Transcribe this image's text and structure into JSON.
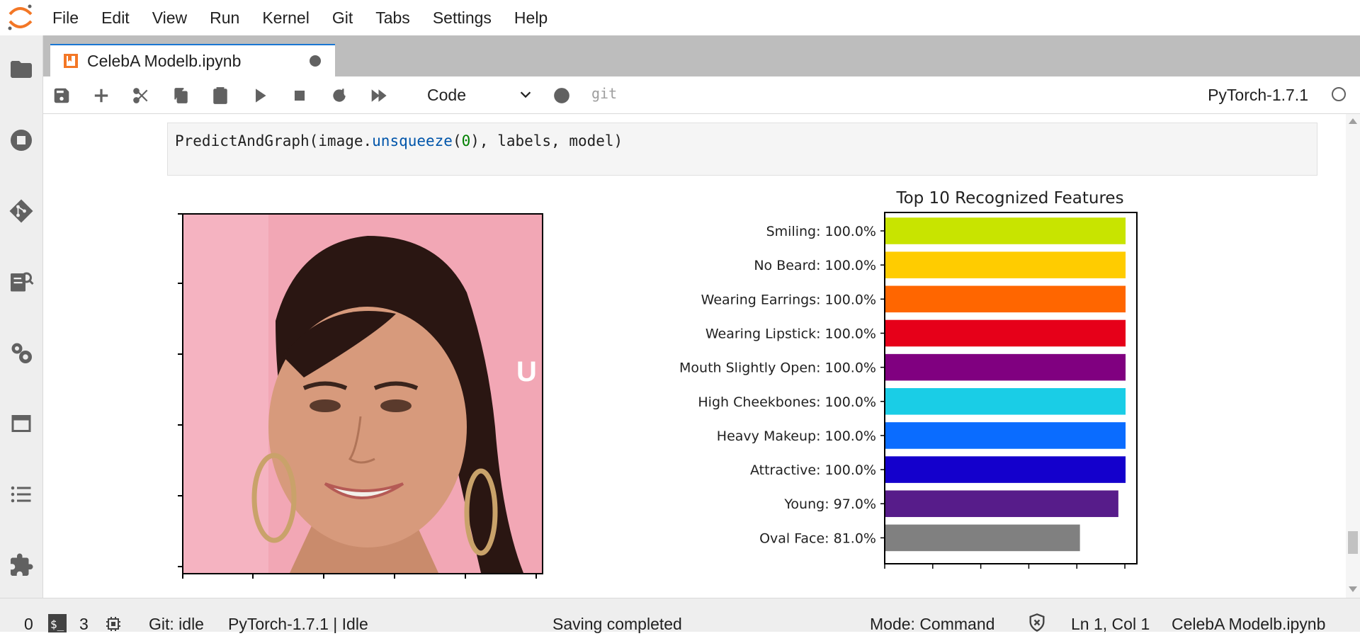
{
  "menu": [
    "File",
    "Edit",
    "View",
    "Run",
    "Kernel",
    "Git",
    "Tabs",
    "Settings",
    "Help"
  ],
  "tab": {
    "title": "CelebA Modelb.ipynb"
  },
  "toolbar": {
    "cell_type": "Code",
    "git_label": "git",
    "kernel_name": "PyTorch-1.7.1"
  },
  "cell": {
    "code_prefix": "PredictAndGraph(image.",
    "code_fn": "unsqueeze",
    "code_open": "(",
    "code_num": "0",
    "code_suffix": "), labels, model)"
  },
  "chart_data": {
    "type": "bar",
    "orientation": "horizontal",
    "title": "Top 10 Recognized Features",
    "categories": [
      "Smiling: 100.0%",
      "No Beard: 100.0%",
      "Wearing Earrings: 100.0%",
      "Wearing Lipstick: 100.0%",
      "Mouth Slightly Open: 100.0%",
      "High Cheekbones: 100.0%",
      "Heavy Makeup: 100.0%",
      "Attractive: 100.0%",
      "Young: 97.0%",
      "Oval Face: 81.0%"
    ],
    "values": [
      100.0,
      100.0,
      100.0,
      100.0,
      100.0,
      100.0,
      100.0,
      100.0,
      97.0,
      81.0
    ],
    "colors": [
      "#c8e400",
      "#ffcc00",
      "#ff6600",
      "#e60019",
      "#800080",
      "#1acde6",
      "#0a6cff",
      "#1400cc",
      "#571c8a",
      "#808080"
    ],
    "xlim": [
      0,
      105
    ],
    "grid": false
  },
  "status": {
    "count_left": "0",
    "terminals": "3",
    "git": "Git: idle",
    "kernel": "PyTorch-1.7.1 | Idle",
    "message": "Saving completed",
    "mode": "Mode: Command",
    "cursor": "Ln 1, Col 1",
    "file": "CelebA Modelb.ipynb"
  }
}
